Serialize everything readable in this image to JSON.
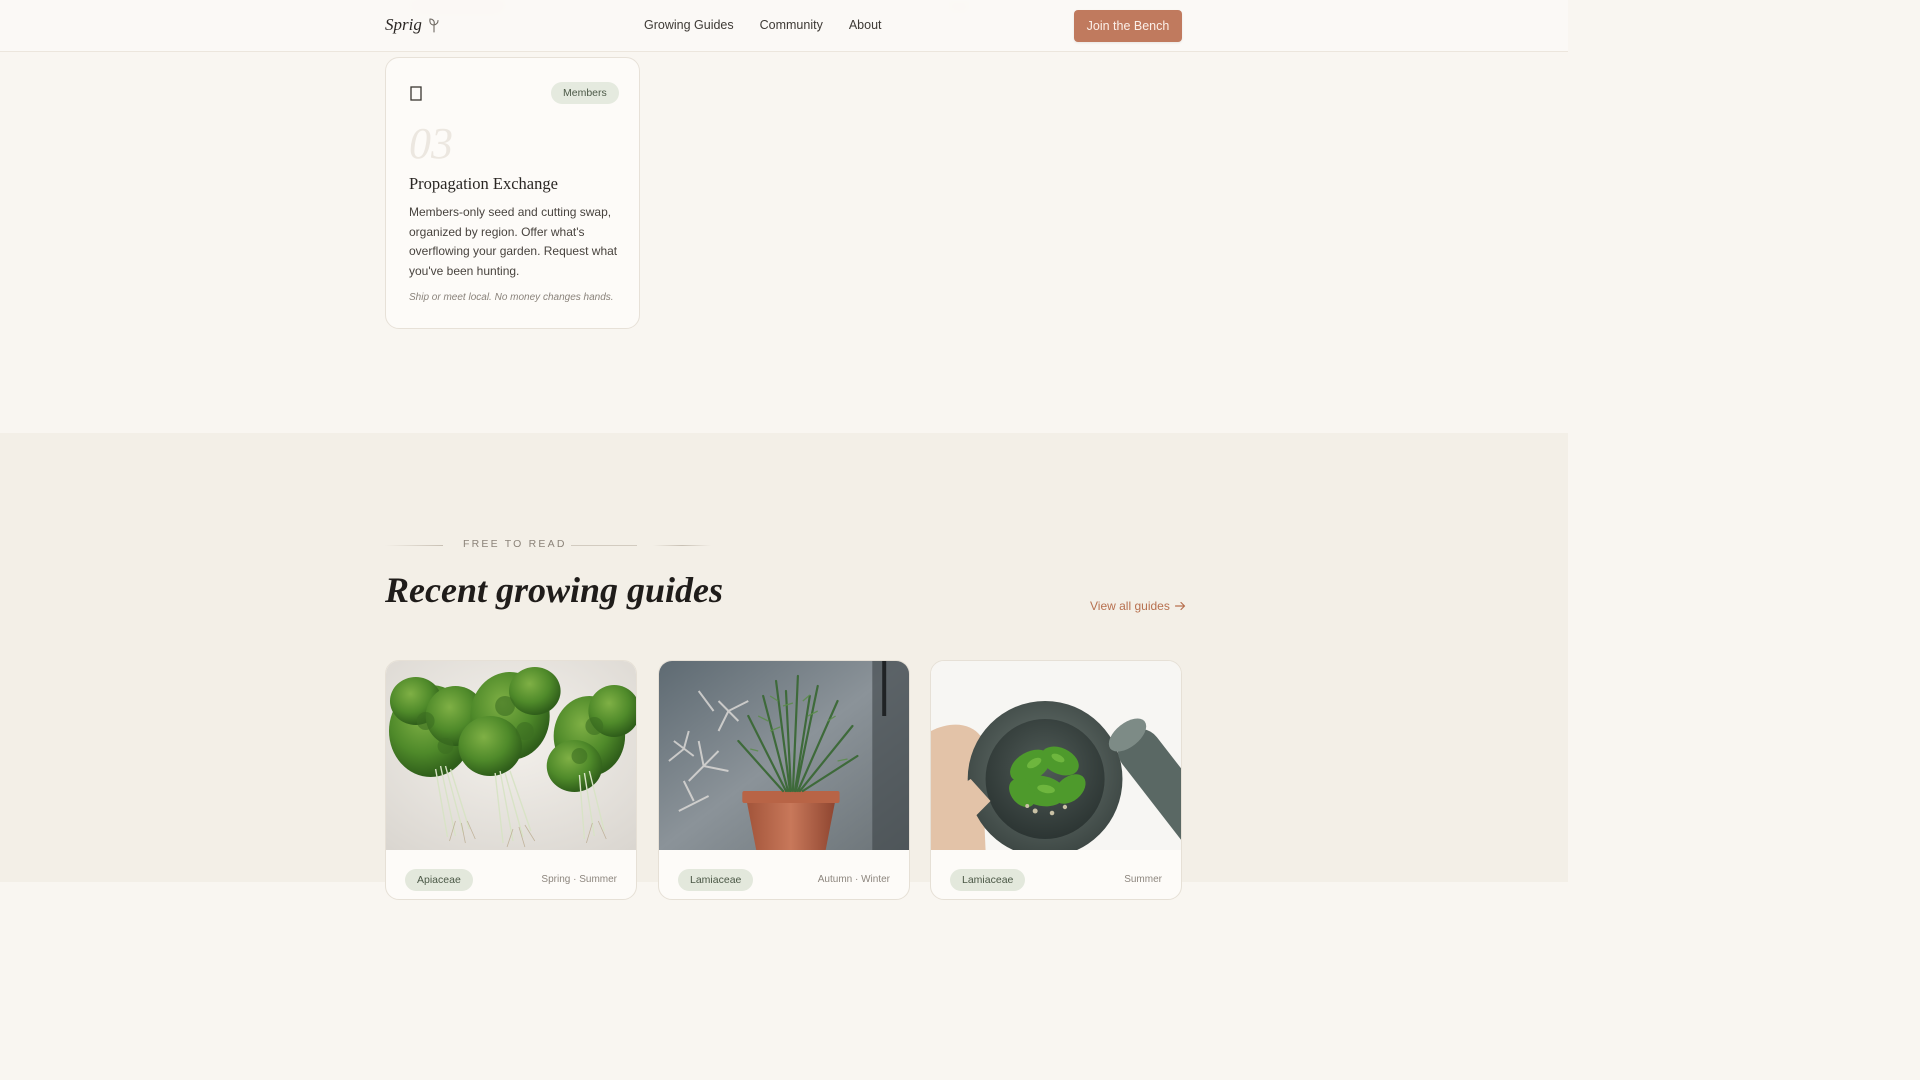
{
  "header": {
    "logo": "Sprig",
    "nav": [
      "Growing Guides",
      "Community",
      "About"
    ],
    "cta": "Join the Bench"
  },
  "feature_card": {
    "badge": "Members",
    "number": "03",
    "title": "Propagation Exchange",
    "body": "Members-only seed and cutting swap, organized by region. Offer what's overflowing your garden. Request what you've been hunting.",
    "note": "Ship or meet local. No money changes hands."
  },
  "guides_section": {
    "eyebrow": "FREE TO READ",
    "title": "Recent growing guides",
    "view_all": "View all guides",
    "cards": [
      {
        "tag": "Apiaceae",
        "season": "Spring · Summer"
      },
      {
        "tag": "Lamiaceae",
        "season": "Autumn · Winter"
      },
      {
        "tag": "Lamiaceae",
        "season": "Summer"
      }
    ]
  },
  "colors": {
    "accent": "#c07a5e",
    "page_bg": "#f9f6f1",
    "section_bg": "#f3efe7",
    "tag_bg": "#e3e8dc"
  }
}
